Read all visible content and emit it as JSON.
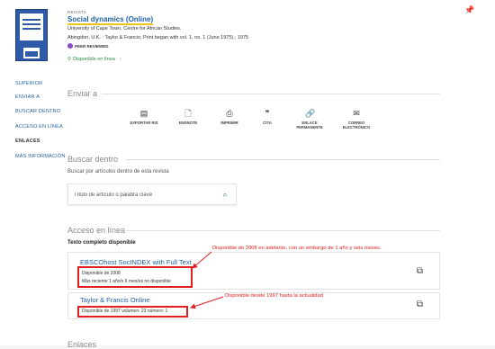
{
  "header": {
    "kicker": "REVISTA",
    "title": "Social dynamics (Online)",
    "publisher": "University of Cape Town. Centre for African Studies.",
    "imprint": "Abingdon, U.K. : Taylor & Francis; Print began with vol. 1, no. 1 (June 1975).; 1975",
    "peer_badge": "PEER REVIEWED",
    "available_link": "Disponible en línea",
    "pin_icon": "pin-icon"
  },
  "nav": {
    "items": [
      {
        "label": "SUPERIOR"
      },
      {
        "label": "ENVIAR A"
      },
      {
        "label": "BUSCAR DENTRO"
      },
      {
        "label": "ACCESO EN LÍNEA"
      },
      {
        "label": "ENLACES"
      },
      {
        "label": "MÁS INFORMACIÓN"
      }
    ],
    "active": "ENLACES"
  },
  "enviar": {
    "heading": "Enviar a",
    "tools": [
      {
        "label": "EXPORTAR RIS",
        "icon": "export-icon"
      },
      {
        "label": "ENDNOTE",
        "icon": "document-icon"
      },
      {
        "label": "IMPRIMIR",
        "icon": "print-icon"
      },
      {
        "label": "CITA",
        "icon": "quote-icon"
      },
      {
        "label": "ENLACE PERMANENTE",
        "icon": "link-icon"
      },
      {
        "label": "CORREO ELECTRÓNICO",
        "icon": "mail-icon"
      }
    ]
  },
  "buscar": {
    "heading": "Buscar dentro",
    "description": "Buscar por artículos dentro de esta revista",
    "placeholder": "Título de artículo o palabra clave"
  },
  "acceso": {
    "heading": "Acceso en línea",
    "subheading": "Texto completo disponible",
    "sources": [
      {
        "name": "EBSCOhost SocINDEX with Full Text",
        "line1": "Disponible de 2008",
        "line2": "Más reciente 1 año/s 6 mes/es no disponible",
        "annotation": "Disponible de 2008 en adelante, con un embargo de 1 año y seis meses."
      },
      {
        "name": "Taylor & Francis Online",
        "line1": "Disponible de 1997 volumen: 23 número: 1",
        "annotation": "Disponible desde 1997 hasta la actualidad"
      }
    ]
  },
  "enlaces": {
    "heading": "Enlaces"
  },
  "colors": {
    "accent": "#1f5fa6",
    "annotation": "#e02020",
    "available": "#2b8a3e"
  }
}
